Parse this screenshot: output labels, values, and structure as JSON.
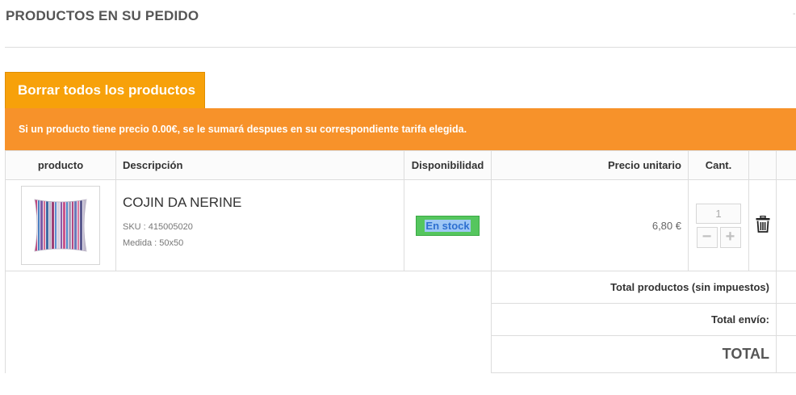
{
  "page": {
    "title": "PRODUCTOS EN SU PEDIDO",
    "corner_mark": "-"
  },
  "clear_button": {
    "label": "Borrar todos los productos"
  },
  "notice": {
    "text": "Si un producto tiene precio 0.00€, se le sumará despues en su correspondiente tarifa elegida."
  },
  "table": {
    "headers": {
      "product": "producto",
      "description": "Descripción",
      "availability": "Disponibilidad",
      "unit_price": "Precio unitario",
      "quantity": "Cant."
    },
    "items": [
      {
        "name": "COJIN DA NERINE",
        "sku": "SKU : 415005020",
        "size": "Medida : 50x50",
        "availability": "En stock",
        "unit_price": "6,80 €",
        "quantity": "1",
        "thumbnail_icon": "striped-cushion-image",
        "minus": "−",
        "plus": "+",
        "delete_icon": "trash-icon"
      }
    ]
  },
  "totals": {
    "products_label": "Total productos (sin impuestos)",
    "shipping_label": "Total envío:",
    "total_label": "TOTAL"
  },
  "colors": {
    "button_orange": "#f7a10a",
    "notice_orange": "#f7922a",
    "stock_green": "#55c65e"
  }
}
